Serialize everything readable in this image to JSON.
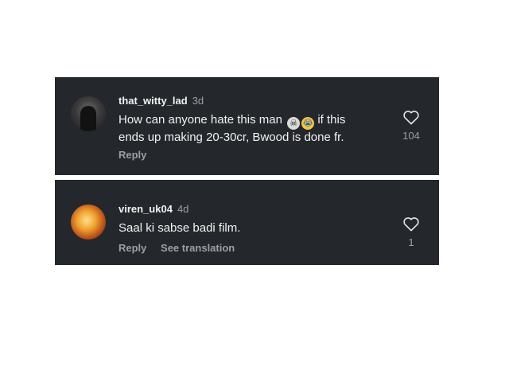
{
  "comments": [
    {
      "username": "that_witty_lad",
      "time": "3d",
      "text": "How can anyone hate this man",
      "text_after_emoji": "if this ends up making 20-30cr, Bwood is done fr.",
      "emojis": [
        "skull",
        "loudly-crying"
      ],
      "reply_label": "Reply",
      "like_count": "104",
      "icon": "heart-icon"
    },
    {
      "username": "viren_uk04",
      "time": "4d",
      "text": "Saal ki sabse badi film.",
      "reply_label": "Reply",
      "translation_label": "See translation",
      "like_count": "1",
      "icon": "heart-icon"
    }
  ],
  "colors": {
    "background": "#24272b",
    "text": "#f2f2f2",
    "muted": "#9aa0a6"
  }
}
